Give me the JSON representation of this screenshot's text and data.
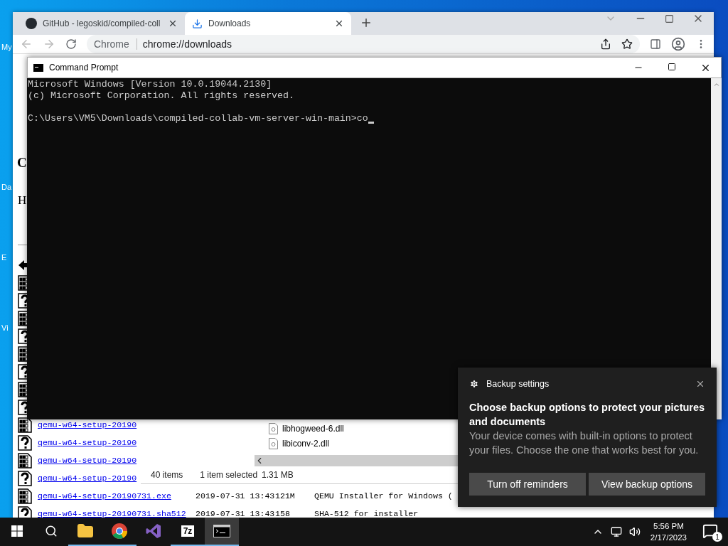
{
  "desktop": {
    "icon_labels": [
      "My",
      "Da",
      "E",
      "Vi"
    ]
  },
  "browser": {
    "tabs": [
      {
        "title": "GitHub - legoskid/compiled-coll",
        "kind": "github",
        "selected": false
      },
      {
        "title": "Downloads",
        "kind": "download",
        "selected": true
      }
    ],
    "address_bar": {
      "chip": "Chrome",
      "url": "chrome://downloads"
    },
    "page": {
      "heading": "C",
      "text": "H",
      "rows": [
        {
          "kind": "parent"
        },
        {
          "kind": "binary"
        },
        {
          "kind": "unknown"
        },
        {
          "kind": "binary"
        },
        {
          "kind": "unknown"
        },
        {
          "kind": "binary"
        },
        {
          "kind": "unknown"
        },
        {
          "kind": "binary"
        },
        {
          "kind": "unknown"
        },
        {
          "kind": "binary",
          "name": "qemu-w64-setup-20190"
        },
        {
          "kind": "unknown",
          "name": "qemu-w64-setup-20190"
        },
        {
          "kind": "binary",
          "name": "qemu-w64-setup-20190"
        },
        {
          "kind": "unknown",
          "name": "qemu-w64-setup-20190"
        },
        {
          "kind": "binary",
          "name": "qemu-w64-setup-20190731.exe",
          "date": "2019-07-31 13:43",
          "size": "121M",
          "description": "QEMU Installer for Windows ("
        },
        {
          "kind": "unknown",
          "name": "qemu-w64-setup-20190731.sha512",
          "date": "2019-07-31 13:43",
          "size": "158",
          "description": "SHA-512 for installer"
        }
      ]
    }
  },
  "explorer": {
    "files": [
      "libhogweed-6.dll",
      "libiconv-2.dll"
    ],
    "status": {
      "count": "40 items",
      "selection": "1 item selected",
      "size": "1.31 MB"
    }
  },
  "console": {
    "title": "Command Prompt",
    "lines": [
      "Microsoft Windows [Version 10.0.19044.2130]",
      "(c) Microsoft Corporation. All rights reserved."
    ],
    "prompt": "C:\\Users\\VM5\\Downloads\\compiled-collab-vm-server-win-main>co"
  },
  "notification": {
    "source": "Backup settings",
    "title": "Choose backup options to protect your pictures and documents",
    "body": "Your device comes with built-in options to protect your files. Choose the one that works best for you.",
    "buttons": [
      "Turn off reminders",
      "View backup options"
    ]
  },
  "taskbar": {
    "apps": [
      {
        "kind": "explorer",
        "open": true,
        "selected": false
      },
      {
        "kind": "chrome",
        "open": true,
        "selected": false
      },
      {
        "kind": "vs",
        "open": false,
        "selected": false
      },
      {
        "kind": "sevenzip",
        "label": "7z",
        "open": true,
        "selected": false
      },
      {
        "kind": "cmd",
        "open": true,
        "selected": true
      }
    ],
    "time": "5:56 PM",
    "date": "2/17/2023",
    "notification_count": "1"
  }
}
